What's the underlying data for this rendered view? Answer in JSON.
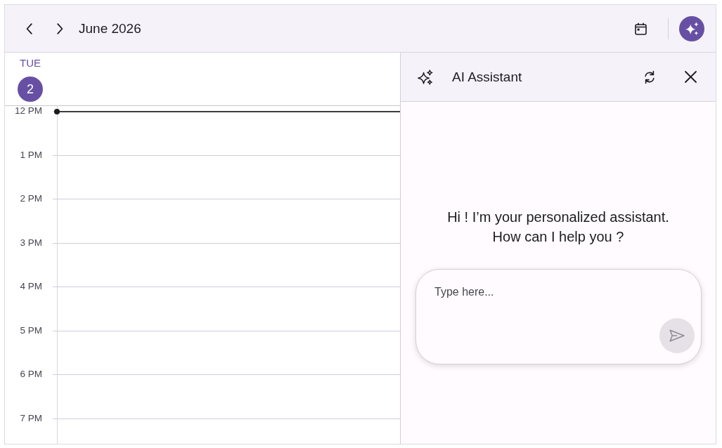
{
  "toolbar": {
    "title": "June 2026"
  },
  "day_view": {
    "weekday": "TUE",
    "date": "2",
    "today": true,
    "current_time_line": true,
    "time_slots": [
      "12 PM",
      "1 PM",
      "2 PM",
      "3 PM",
      "4 PM",
      "5 PM",
      "6 PM",
      "7 PM"
    ]
  },
  "assistant": {
    "title": "AI Assistant",
    "greeting": "Hi ! I’m your personalized assistant. How can I help you ?",
    "input": {
      "placeholder": "Type here..."
    },
    "send_button": {
      "disabled": true
    }
  }
}
